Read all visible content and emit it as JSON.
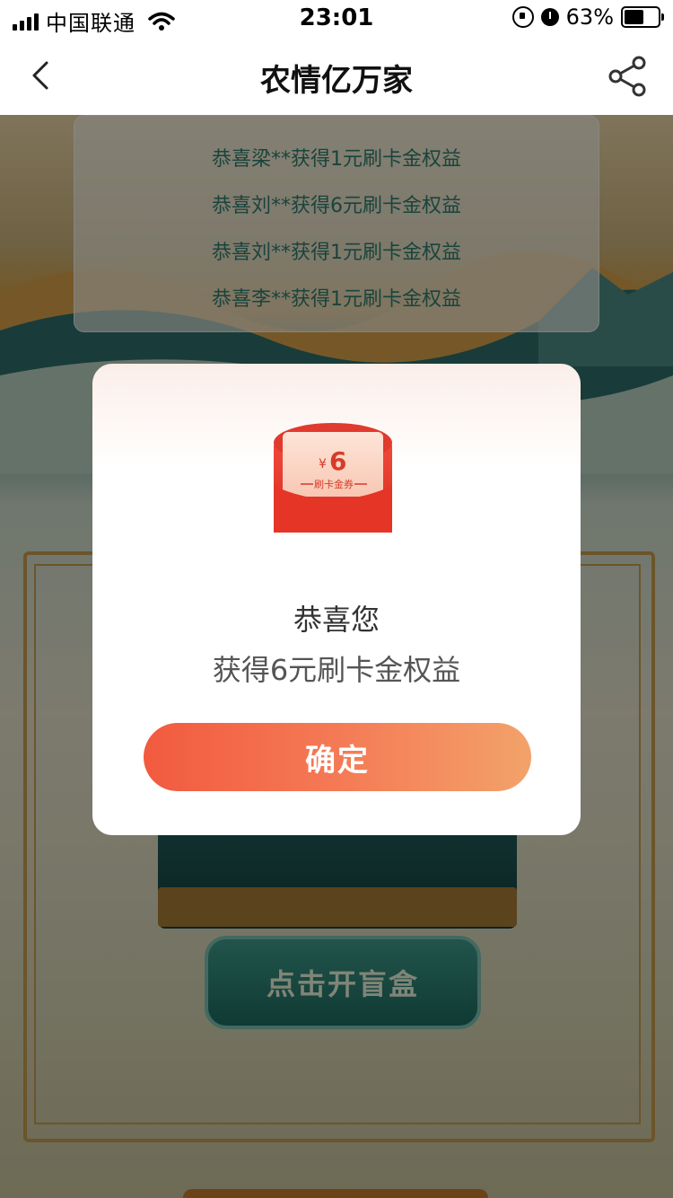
{
  "status_bar": {
    "carrier": "中国联通",
    "time": "23:01",
    "battery_percent": "63%",
    "battery_level": 0.63,
    "icons": [
      "signal-icon",
      "wifi-icon",
      "rotation-lock-icon",
      "alarm-icon",
      "battery-icon"
    ]
  },
  "nav": {
    "title": "农情亿万家",
    "back_icon": "chevron-left-icon",
    "share_icon": "share-icon"
  },
  "background": {
    "winners": [
      "恭喜梁**获得1元刷卡金权益",
      "恭喜刘**获得6元刷卡金权益",
      "恭喜刘**获得1元刷卡金权益",
      "恭喜李**获得1元刷卡金权益"
    ],
    "open_box_label": "点击开盲盒"
  },
  "modal": {
    "coupon_currency": "¥",
    "coupon_amount": "6",
    "coupon_label": "刷卡金券",
    "title": "恭喜您",
    "subtitle": "获得6元刷卡金权益",
    "confirm_label": "确定"
  },
  "colors": {
    "confirm_start": "#f25a3f",
    "confirm_end": "#f3a26a",
    "coupon_red": "#e53a2b",
    "winner_text": "#2e7d6e"
  }
}
